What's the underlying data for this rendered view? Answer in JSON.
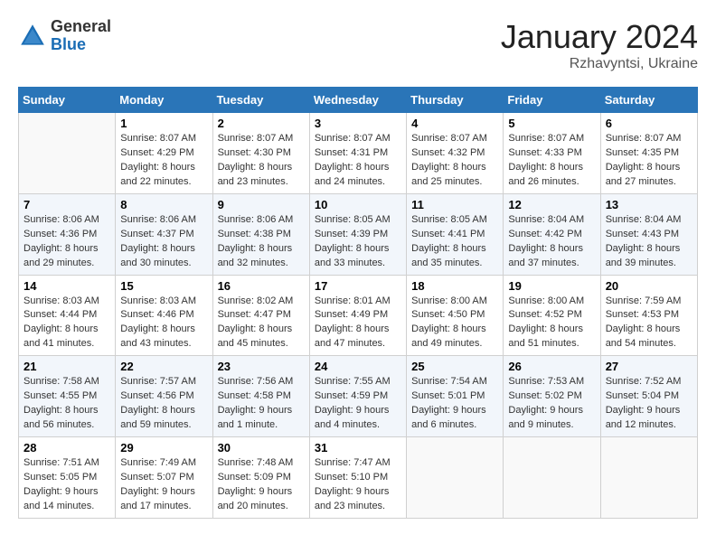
{
  "header": {
    "logo_general": "General",
    "logo_blue": "Blue",
    "month_title": "January 2024",
    "subtitle": "Rzhavyntsi, Ukraine"
  },
  "weekdays": [
    "Sunday",
    "Monday",
    "Tuesday",
    "Wednesday",
    "Thursday",
    "Friday",
    "Saturday"
  ],
  "weeks": [
    [
      {
        "day": "",
        "sunrise": "",
        "sunset": "",
        "daylight": ""
      },
      {
        "day": "1",
        "sunrise": "Sunrise: 8:07 AM",
        "sunset": "Sunset: 4:29 PM",
        "daylight": "Daylight: 8 hours and 22 minutes."
      },
      {
        "day": "2",
        "sunrise": "Sunrise: 8:07 AM",
        "sunset": "Sunset: 4:30 PM",
        "daylight": "Daylight: 8 hours and 23 minutes."
      },
      {
        "day": "3",
        "sunrise": "Sunrise: 8:07 AM",
        "sunset": "Sunset: 4:31 PM",
        "daylight": "Daylight: 8 hours and 24 minutes."
      },
      {
        "day": "4",
        "sunrise": "Sunrise: 8:07 AM",
        "sunset": "Sunset: 4:32 PM",
        "daylight": "Daylight: 8 hours and 25 minutes."
      },
      {
        "day": "5",
        "sunrise": "Sunrise: 8:07 AM",
        "sunset": "Sunset: 4:33 PM",
        "daylight": "Daylight: 8 hours and 26 minutes."
      },
      {
        "day": "6",
        "sunrise": "Sunrise: 8:07 AM",
        "sunset": "Sunset: 4:35 PM",
        "daylight": "Daylight: 8 hours and 27 minutes."
      }
    ],
    [
      {
        "day": "7",
        "sunrise": "Sunrise: 8:06 AM",
        "sunset": "Sunset: 4:36 PM",
        "daylight": "Daylight: 8 hours and 29 minutes."
      },
      {
        "day": "8",
        "sunrise": "Sunrise: 8:06 AM",
        "sunset": "Sunset: 4:37 PM",
        "daylight": "Daylight: 8 hours and 30 minutes."
      },
      {
        "day": "9",
        "sunrise": "Sunrise: 8:06 AM",
        "sunset": "Sunset: 4:38 PM",
        "daylight": "Daylight: 8 hours and 32 minutes."
      },
      {
        "day": "10",
        "sunrise": "Sunrise: 8:05 AM",
        "sunset": "Sunset: 4:39 PM",
        "daylight": "Daylight: 8 hours and 33 minutes."
      },
      {
        "day": "11",
        "sunrise": "Sunrise: 8:05 AM",
        "sunset": "Sunset: 4:41 PM",
        "daylight": "Daylight: 8 hours and 35 minutes."
      },
      {
        "day": "12",
        "sunrise": "Sunrise: 8:04 AM",
        "sunset": "Sunset: 4:42 PM",
        "daylight": "Daylight: 8 hours and 37 minutes."
      },
      {
        "day": "13",
        "sunrise": "Sunrise: 8:04 AM",
        "sunset": "Sunset: 4:43 PM",
        "daylight": "Daylight: 8 hours and 39 minutes."
      }
    ],
    [
      {
        "day": "14",
        "sunrise": "Sunrise: 8:03 AM",
        "sunset": "Sunset: 4:44 PM",
        "daylight": "Daylight: 8 hours and 41 minutes."
      },
      {
        "day": "15",
        "sunrise": "Sunrise: 8:03 AM",
        "sunset": "Sunset: 4:46 PM",
        "daylight": "Daylight: 8 hours and 43 minutes."
      },
      {
        "day": "16",
        "sunrise": "Sunrise: 8:02 AM",
        "sunset": "Sunset: 4:47 PM",
        "daylight": "Daylight: 8 hours and 45 minutes."
      },
      {
        "day": "17",
        "sunrise": "Sunrise: 8:01 AM",
        "sunset": "Sunset: 4:49 PM",
        "daylight": "Daylight: 8 hours and 47 minutes."
      },
      {
        "day": "18",
        "sunrise": "Sunrise: 8:00 AM",
        "sunset": "Sunset: 4:50 PM",
        "daylight": "Daylight: 8 hours and 49 minutes."
      },
      {
        "day": "19",
        "sunrise": "Sunrise: 8:00 AM",
        "sunset": "Sunset: 4:52 PM",
        "daylight": "Daylight: 8 hours and 51 minutes."
      },
      {
        "day": "20",
        "sunrise": "Sunrise: 7:59 AM",
        "sunset": "Sunset: 4:53 PM",
        "daylight": "Daylight: 8 hours and 54 minutes."
      }
    ],
    [
      {
        "day": "21",
        "sunrise": "Sunrise: 7:58 AM",
        "sunset": "Sunset: 4:55 PM",
        "daylight": "Daylight: 8 hours and 56 minutes."
      },
      {
        "day": "22",
        "sunrise": "Sunrise: 7:57 AM",
        "sunset": "Sunset: 4:56 PM",
        "daylight": "Daylight: 8 hours and 59 minutes."
      },
      {
        "day": "23",
        "sunrise": "Sunrise: 7:56 AM",
        "sunset": "Sunset: 4:58 PM",
        "daylight": "Daylight: 9 hours and 1 minute."
      },
      {
        "day": "24",
        "sunrise": "Sunrise: 7:55 AM",
        "sunset": "Sunset: 4:59 PM",
        "daylight": "Daylight: 9 hours and 4 minutes."
      },
      {
        "day": "25",
        "sunrise": "Sunrise: 7:54 AM",
        "sunset": "Sunset: 5:01 PM",
        "daylight": "Daylight: 9 hours and 6 minutes."
      },
      {
        "day": "26",
        "sunrise": "Sunrise: 7:53 AM",
        "sunset": "Sunset: 5:02 PM",
        "daylight": "Daylight: 9 hours and 9 minutes."
      },
      {
        "day": "27",
        "sunrise": "Sunrise: 7:52 AM",
        "sunset": "Sunset: 5:04 PM",
        "daylight": "Daylight: 9 hours and 12 minutes."
      }
    ],
    [
      {
        "day": "28",
        "sunrise": "Sunrise: 7:51 AM",
        "sunset": "Sunset: 5:05 PM",
        "daylight": "Daylight: 9 hours and 14 minutes."
      },
      {
        "day": "29",
        "sunrise": "Sunrise: 7:49 AM",
        "sunset": "Sunset: 5:07 PM",
        "daylight": "Daylight: 9 hours and 17 minutes."
      },
      {
        "day": "30",
        "sunrise": "Sunrise: 7:48 AM",
        "sunset": "Sunset: 5:09 PM",
        "daylight": "Daylight: 9 hours and 20 minutes."
      },
      {
        "day": "31",
        "sunrise": "Sunrise: 7:47 AM",
        "sunset": "Sunset: 5:10 PM",
        "daylight": "Daylight: 9 hours and 23 minutes."
      },
      {
        "day": "",
        "sunrise": "",
        "sunset": "",
        "daylight": ""
      },
      {
        "day": "",
        "sunrise": "",
        "sunset": "",
        "daylight": ""
      },
      {
        "day": "",
        "sunrise": "",
        "sunset": "",
        "daylight": ""
      }
    ]
  ]
}
